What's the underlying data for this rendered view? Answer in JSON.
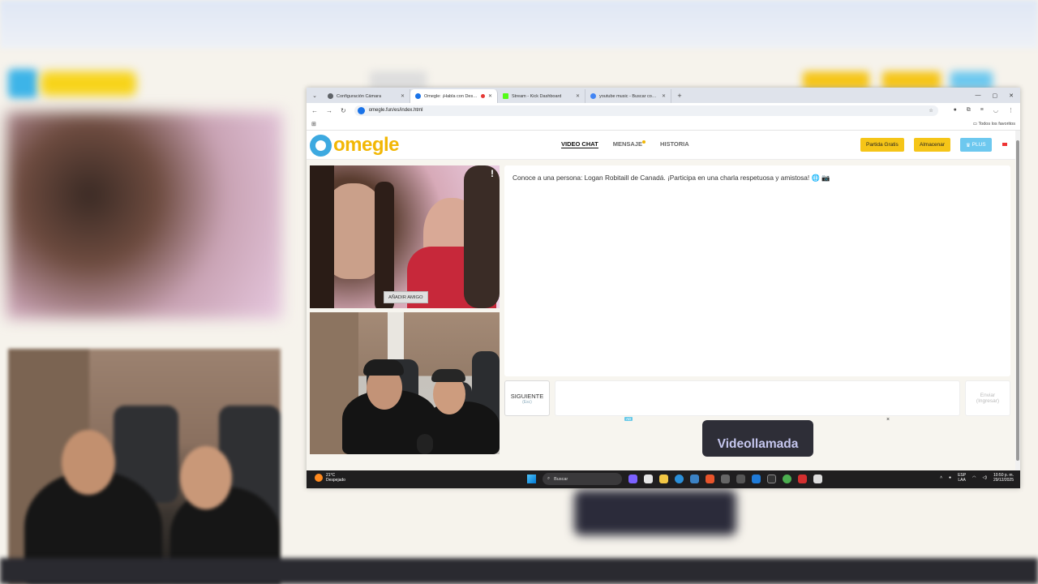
{
  "browser": {
    "tabs": [
      {
        "label": "Configuración Cámara",
        "color": "#5f6368",
        "active": false
      },
      {
        "label": "Omegle: ¡Habla con Desco...",
        "color": "#1a73e8",
        "active": true
      },
      {
        "label": "Stream - Kick Dashboard",
        "color": "#53fc18",
        "active": false
      },
      {
        "label": "youtube music - Buscar con Go...",
        "color": "#4285f4",
        "active": false
      }
    ],
    "new_tab": "+",
    "url": "omegle.fun/es/index.html",
    "bookmarks_label": "Todos los favoritos"
  },
  "site": {
    "logo_text": "omegle",
    "nav": {
      "video_chat": "VIDEO CHAT",
      "mensaje": "MENSAJE",
      "historia": "HISTORIA"
    },
    "buttons": {
      "partida": "Partida Gratis",
      "almacenar": "Almacenar",
      "plus": "PLUS"
    },
    "stranger_video": {
      "report": "!",
      "add_friend": "AÑADIR AMIGO"
    },
    "chat": {
      "message": "Conoce a una persona: Logan Robitaill de Canadá. ¡Participa en una charla respetuosa y amistosa! 🌐 📷"
    },
    "controls": {
      "next": "SIGUIENTE",
      "next_sub": "(Esc)",
      "send": "Enviar",
      "send_sub": "(Ingresar)"
    },
    "ad": {
      "badge": "AD",
      "close": "×",
      "banner": "Videollamada"
    }
  },
  "taskbar": {
    "weather_temp": "21°C",
    "weather_desc": "Despejado",
    "search": "Buscar",
    "lang": "ESP",
    "region": "LAA",
    "time": "10:50 p. m.",
    "date": "29/12/2025"
  }
}
